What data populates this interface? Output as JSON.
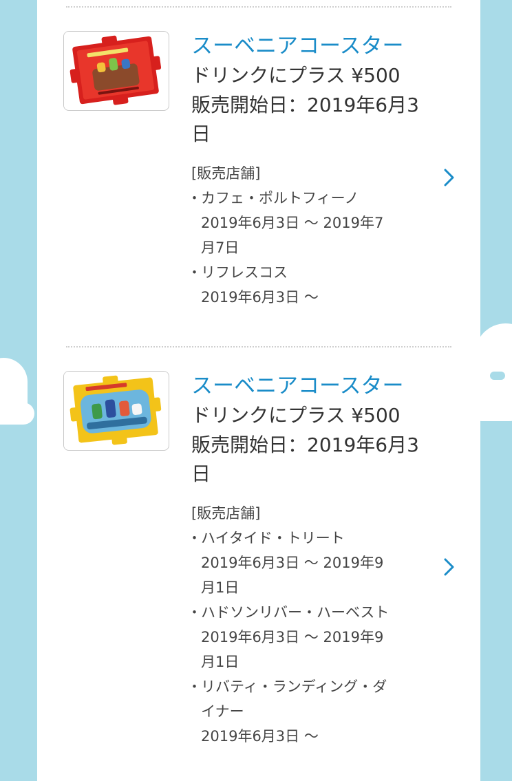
{
  "colors": {
    "background": "#a9dbe8",
    "panel": "#ffffff",
    "title": "#1a8cc8",
    "text": "#333333",
    "chevron": "#1a8cc8"
  },
  "items": [
    {
      "image": "red-puzzle-coaster",
      "title": "スーベニアコースター",
      "price": "ドリンクにプラス ¥500",
      "release_line1": "販売開始日：2019年6月3",
      "release_line2": "日",
      "stores_label": "[販売店舗]",
      "stores": [
        {
          "bullet": "・",
          "name": "カフェ・ポルトフィーノ",
          "dates_line1": "2019年6月3日 〜 2019年7",
          "dates_line2": "月7日"
        },
        {
          "bullet": "・",
          "name": "リフレスコス",
          "dates_line1": "2019年6月3日 〜",
          "dates_line2": ""
        }
      ],
      "chevron_icon": "chevron-right-icon"
    },
    {
      "image": "yellow-puzzle-coaster",
      "title": "スーベニアコースター",
      "price": "ドリンクにプラス ¥500",
      "release_line1": "販売開始日：2019年6月3",
      "release_line2": "日",
      "stores_label": "[販売店舗]",
      "stores": [
        {
          "bullet": "・",
          "name": "ハイタイド・トリート",
          "dates_line1": "2019年6月3日 〜 2019年9",
          "dates_line2": "月1日"
        },
        {
          "bullet": "・",
          "name": "ハドソンリバー・ハーベスト",
          "dates_line1": "2019年6月3日 〜 2019年9",
          "dates_line2": "月1日"
        },
        {
          "bullet": "・",
          "name_line1": "リバティ・ランディング・ダ",
          "name_line2": "イナー",
          "dates_line1": "2019年6月3日 〜",
          "dates_line2": ""
        }
      ],
      "chevron_icon": "chevron-right-icon"
    }
  ]
}
